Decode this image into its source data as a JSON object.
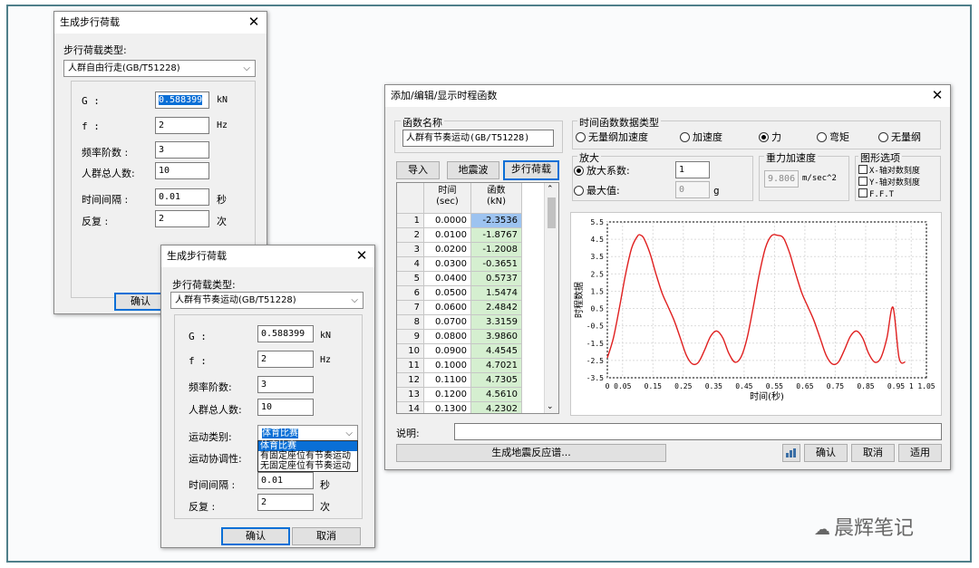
{
  "colors": {
    "frame": "#4f7f8a",
    "accent": "#0a6fd6",
    "curve": "#e02020",
    "value_cells": "#d5efd0"
  },
  "dlg1": {
    "title": "生成步行荷载",
    "type_label": "步行荷载类型:",
    "type_value": "人群自由行走(GB/T51228)",
    "g_label": "G :",
    "g_value": "0.588399",
    "g_unit": "kN",
    "f_label": "f :",
    "f_value": "2",
    "f_unit": "Hz",
    "order_label": "频率阶数 :",
    "order_value": "3",
    "people_label": "人群总人数:",
    "people_value": "10",
    "interval_label": "时间间隔 :",
    "interval_value": "0.01",
    "interval_unit": "秒",
    "repeat_label": "反复 :",
    "repeat_value": "2",
    "repeat_unit": "次",
    "ok": "确认"
  },
  "dlg2": {
    "title": "生成步行荷载",
    "type_label": "步行荷载类型:",
    "type_value": "人群有节奏运动(GB/T51228)",
    "g_label": "G :",
    "g_value": "0.588399",
    "g_unit": "kN",
    "f_label": "f :",
    "f_value": "2",
    "f_unit": "Hz",
    "order_label": "频率阶数:",
    "order_value": "3",
    "people_label": "人群总人数:",
    "people_value": "10",
    "motion_label": "运动类别:",
    "motion_value": "体育比赛",
    "motion_options": [
      "体育比赛",
      "有固定座位有节奏运动",
      "无固定座位有节奏运动"
    ],
    "coord_label": "运动协调性:",
    "interval_label": "时间间隔 :",
    "interval_value": "0.01",
    "interval_unit": "秒",
    "repeat_label": "反复 :",
    "repeat_value": "2",
    "repeat_unit": "次",
    "ok": "确认",
    "cancel": "取消"
  },
  "main": {
    "title": "添加/编辑/显示时程函数",
    "func_name_label": "函数名称",
    "func_name_value": "人群有节奏运动(GB/T51228)",
    "btn_import": "导入",
    "btn_quake": "地震波",
    "btn_walk": "步行荷载",
    "table": {
      "col_time": "时间",
      "col_time_unit": "(sec)",
      "col_func": "函数",
      "col_func_unit": "(kN)",
      "rows": [
        [
          "1",
          "0.0000",
          "-2.3536"
        ],
        [
          "2",
          "0.0100",
          "-1.8767"
        ],
        [
          "3",
          "0.0200",
          "-1.2008"
        ],
        [
          "4",
          "0.0300",
          "-0.3651"
        ],
        [
          "5",
          "0.0400",
          "0.5737"
        ],
        [
          "6",
          "0.0500",
          "1.5474"
        ],
        [
          "7",
          "0.0600",
          "2.4842"
        ],
        [
          "8",
          "0.0700",
          "3.3159"
        ],
        [
          "9",
          "0.0800",
          "3.9860"
        ],
        [
          "10",
          "0.0900",
          "4.4545"
        ],
        [
          "11",
          "0.1000",
          "4.7021"
        ],
        [
          "12",
          "0.1100",
          "4.7305"
        ],
        [
          "13",
          "0.1200",
          "4.5610"
        ],
        [
          "14",
          "0.1300",
          "4.2302"
        ]
      ]
    },
    "type_group_label": "时间函数数据类型",
    "type_options": [
      "无量纲加速度",
      "加速度",
      "力",
      "弯矩",
      "无量纲"
    ],
    "type_selected": 2,
    "scale_group_label": "放大",
    "scale_factor_label": "放大系数:",
    "scale_factor_value": "1",
    "max_label": "最大值:",
    "max_value": "0",
    "max_unit": "g",
    "gravity_group_label": "重力加速度",
    "gravity_value": "9.806",
    "gravity_unit": "m/sec^2",
    "graph_group_label": "图形选项",
    "graph_options": [
      "X-轴对数刻度",
      "Y-轴对数刻度",
      "F.F.T"
    ],
    "desc_label": "说明:",
    "desc_value": "",
    "btn_spectrum": "生成地震反应谱...",
    "btn_ok": "确认",
    "btn_cancel": "取消",
    "btn_apply": "适用"
  },
  "chart_data": {
    "type": "line",
    "xlabel": "时间(秒)",
    "ylabel": "时程数据",
    "xlim": [
      0,
      1.05
    ],
    "ylim": [
      -3.5,
      5.5
    ],
    "xticks": [
      "0",
      "0.05",
      "0.15",
      "0.25",
      "0.35",
      "0.45",
      "0.55",
      "0.65",
      "0.75",
      "0.85",
      "0.95",
      "1",
      "1.05"
    ],
    "xtick_values": [
      0,
      0.05,
      0.15,
      0.25,
      0.35,
      0.45,
      0.55,
      0.65,
      0.75,
      0.85,
      0.95,
      1.0,
      1.05
    ],
    "yticks": [
      "5.5",
      "4.5",
      "3.5",
      "2.5",
      "1.5",
      "0.5",
      "-0.5",
      "-1.5",
      "-2.5",
      "-3.5"
    ],
    "ytick_values": [
      5.5,
      4.5,
      3.5,
      2.5,
      1.5,
      0.5,
      -0.5,
      -1.5,
      -2.5,
      -3.5
    ],
    "grid": true,
    "series": [
      {
        "x": [
          0,
          0.02,
          0.04,
          0.06,
          0.08,
          0.1,
          0.11,
          0.12,
          0.14,
          0.16,
          0.18,
          0.2,
          0.22,
          0.24,
          0.26,
          0.28,
          0.3,
          0.32,
          0.34,
          0.36,
          0.38,
          0.4,
          0.42,
          0.44,
          0.46,
          0.48,
          0.5,
          0.52,
          0.54,
          0.56,
          0.58,
          0.6,
          0.61,
          0.62,
          0.64,
          0.66,
          0.68,
          0.7,
          0.72,
          0.74,
          0.76,
          0.78,
          0.8,
          0.82,
          0.84,
          0.86,
          0.88,
          0.9,
          0.92,
          0.94,
          0.96,
          0.98
        ],
        "y": [
          -2.35,
          -1.2,
          0.57,
          2.48,
          3.99,
          4.7,
          4.73,
          4.56,
          3.7,
          2.5,
          1.4,
          0.6,
          -0.2,
          -1.2,
          -2.2,
          -2.7,
          -2.6,
          -1.9,
          -1.1,
          -0.8,
          -1.2,
          -2.1,
          -2.6,
          -2.3,
          -1.2,
          0.57,
          2.48,
          3.99,
          4.7,
          4.73,
          4.56,
          3.7,
          3.1,
          2.5,
          1.4,
          0.6,
          -0.2,
          -1.2,
          -2.2,
          -2.7,
          -2.6,
          -1.9,
          -1.1,
          -0.8,
          -1.2,
          -2.1,
          -2.6,
          -2.35,
          -1.2,
          0.57,
          -2.35,
          -2.6
        ]
      }
    ]
  },
  "watermark": "晨辉笔记"
}
